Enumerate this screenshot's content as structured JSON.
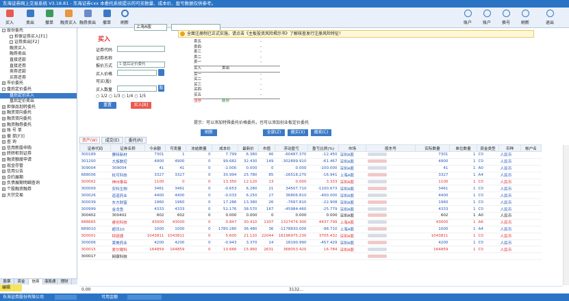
{
  "titlebar": {
    "text": "东海证券网上交易系统 V3.18.81 - 东海证券cxx  本委托系统提示的可买数量、成本价、盈亏数据仅供参考。"
  },
  "toolbar": {
    "left": [
      "买入",
      "卖出",
      "撤单",
      "融资买入",
      "融券卖出",
      "撤单",
      "刷新"
    ],
    "market": "上海A股",
    "right": [
      "账户",
      "账户",
      "账号",
      "换号",
      "刷新",
      "退出"
    ]
  },
  "notice": "全面注册制已正式实施，请点击《主板投资风险揭示书》了解核查发行注册风险特征！",
  "sidebar": {
    "items": [
      {
        "label": "股份委托",
        "level": 0,
        "box": "-"
      },
      {
        "label": "担保证券买入[F1]",
        "level": 1,
        "box": "-"
      },
      {
        "label": "证券卖出[F2]",
        "level": 1,
        "box": "-"
      },
      {
        "label": "融资买入",
        "level": 1
      },
      {
        "label": "融券卖出",
        "level": 1
      },
      {
        "label": "直接还款",
        "level": 1
      },
      {
        "label": "直接还券",
        "level": 1
      },
      {
        "label": "卖券还款",
        "level": 1
      },
      {
        "label": "买券还券",
        "level": 1
      },
      {
        "label": "市价委托",
        "level": 0,
        "box": "+"
      },
      {
        "label": "盘后定价委托",
        "level": 0,
        "box": "-"
      },
      {
        "label": "盘后定价买入",
        "level": 1,
        "selected": true
      },
      {
        "label": "盘后定价卖出",
        "level": 1
      },
      {
        "label": "担保品划转委托",
        "level": 0,
        "box": "+"
      },
      {
        "label": "融资双向委托",
        "level": 0,
        "box": "+"
      },
      {
        "label": "融资双向委托",
        "level": 0,
        "box": "+"
      },
      {
        "label": "融资融券委托",
        "level": 0,
        "box": "+"
      },
      {
        "label": "账 号 单",
        "level": 0,
        "box": "+"
      },
      {
        "label": "撤    单[F3]",
        "level": 0,
        "box": "+"
      },
      {
        "label": "查    询",
        "level": 0,
        "box": "+"
      },
      {
        "label": "信用新股申购",
        "level": 0,
        "box": "+"
      },
      {
        "label": "转转柜到证券",
        "level": 0,
        "box": "+"
      },
      {
        "label": "融资额度申请",
        "level": 0,
        "box": "+"
      },
      {
        "label": "现金存管",
        "level": 0,
        "box": "+"
      },
      {
        "label": "信用公告",
        "level": 0,
        "box": "+"
      },
      {
        "label": "合约展期",
        "level": 0,
        "box": "+"
      },
      {
        "label": "负债展期明细查询",
        "level": 0,
        "box": "+"
      },
      {
        "label": "个股融资融券",
        "level": 0,
        "box": "+"
      },
      {
        "label": "大宗交易",
        "level": 0,
        "box": "+"
      }
    ],
    "tabs": [
      "股票",
      "资金",
      "信用",
      "港股通",
      "理财"
    ],
    "edit": "编辑"
  },
  "form": {
    "title": "买入",
    "code_label": "证券代码",
    "name_label": "证券名称",
    "method_label": "报价方式",
    "method_value": "1-盘后定价委托",
    "price_label": "买入价格",
    "max_label": "可买(股)",
    "qty_label": "买入数量",
    "unit": "股",
    "radios": [
      "1/2",
      "1/3",
      "1/4",
      "1/5"
    ],
    "reset": "重置",
    "buy": "买入[B]"
  },
  "orderbook": {
    "sells": [
      "卖五",
      "卖四",
      "卖三",
      "卖二",
      "卖一"
    ],
    "buys": [
      "买一",
      "买二",
      "买三",
      "买四",
      "买五"
    ],
    "mid_labels": [
      "买入",
      "卖出"
    ],
    "bottom": [
      "涨停",
      "跌停"
    ],
    "dash": "-"
  },
  "hint": "提示：可以添加特殊委托价格委托，也可以添加创业板定价委托",
  "grid": {
    "tabs": [
      "资产(W)",
      "成交(E)",
      "委托(R)"
    ],
    "tool_buttons": [
      "刷新",
      "全部(Z)",
      "撤买(X)",
      "撤卖(C)"
    ],
    "headers": [
      "证券代码",
      "证券名称",
      "今余额",
      "可卖量",
      "冻结数量",
      "成本价",
      "最新价",
      "市值",
      "浮动盈亏",
      "盈亏比例(%)",
      "市场",
      "股东号",
      "实际数量",
      "单位数量",
      "资金类型",
      "币种",
      "帐户名"
    ],
    "rows": [
      [
        "300189",
        "赛特新材",
        "7301",
        "1",
        "0",
        "7.799",
        "6.380",
        "46",
        "-60487.370",
        "-12.450",
        "深圳A股",
        "7301",
        "1",
        "C0",
        "人民币"
      ],
      [
        "301200",
        "大族数控",
        "4900",
        "4900",
        "0",
        "99.682",
        "32.430",
        "149",
        "-302899.910",
        "-61.467",
        "深圳A股",
        "4900",
        "1",
        "C0",
        "人民币"
      ],
      [
        "309004",
        "309004",
        "41",
        "41",
        "0",
        "-1.000",
        "0.000",
        "0",
        "0.000",
        "-100.000",
        "深圳A股",
        "41",
        "1",
        "A0",
        "人民币"
      ],
      [
        "688006",
        "杭可科技",
        "3327",
        "3327",
        "0",
        "30.994",
        "25.780",
        "85",
        "-26518.270",
        "-16.941",
        "上海A股",
        "3327",
        "1",
        "A4",
        "人民币"
      ],
      [
        "300002",
        "神州泰岳",
        "1100",
        "0",
        "0",
        "13.350",
        "12.120",
        "13",
        "0.000",
        "3.333",
        "深圳A股",
        "1100",
        "1",
        "C0",
        "人民币"
      ],
      [
        "300009",
        "安科生物",
        "3461",
        "3461",
        "0",
        "-0.653",
        "6.280",
        "21",
        "34507.710",
        "-1100.673",
        "深圳A股",
        "3461",
        "1",
        "C0",
        "人民币"
      ],
      [
        "300026",
        "道道药业",
        "4400",
        "4400",
        "0",
        "-0.033",
        "6.250",
        "27",
        "36806.810",
        "-400.000",
        "深圳A股",
        "4400",
        "1",
        "C0",
        "人民币"
      ],
      [
        "300039",
        "东方财富",
        "1960",
        "1960",
        "0",
        "17.286",
        "13.380",
        "26",
        "-7697.810",
        "-22.908",
        "深圳A股",
        "1960",
        "1",
        "C0",
        "人民币"
      ],
      [
        "300999",
        "金龙鱼",
        "4333",
        "4333",
        "0",
        "51.176",
        "38.570",
        "167",
        "-45984.460",
        "-25.779",
        "深圳A股",
        "4333",
        "1",
        "C0",
        "人民币"
      ],
      [
        "300402",
        "300402",
        "602",
        "602",
        "0",
        "0.000",
        "0.000",
        "0",
        "0.000",
        "0.000",
        "深圳A股",
        "602",
        "1",
        "A0",
        "人民币"
      ],
      [
        "688665",
        "睿创科技",
        "43000",
        "43000",
        "0",
        "0.847",
        "30.410",
        "1307",
        "1327474.300",
        "4437.799",
        "上海A股",
        "43000",
        "1",
        "AK",
        "人民币"
      ],
      [
        "689010",
        "超讯10",
        "1000",
        "1000",
        "0",
        "1780.280",
        "36.480",
        "36",
        "-1178830.000",
        "-98.710",
        "上海A股",
        "1000",
        "1",
        "A4",
        "人民币"
      ],
      [
        "300001",
        "特锐德",
        "1043811",
        "1043811",
        "0",
        "5.600",
        "21.120",
        "22044",
        "16196975.230",
        "3705.432",
        "深圳A股",
        "1043811",
        "1",
        "C0",
        "人民币"
      ],
      [
        "300006",
        "莱美药业",
        "4200",
        "4200",
        "0",
        "-0.943",
        "3.370",
        "14",
        "18190.990",
        "-457.429",
        "深圳A股",
        "4200",
        "1",
        "C0",
        "人民币"
      ],
      [
        "300015",
        "爱尔眼科",
        "164859",
        "164859",
        "0",
        "13.666",
        "15.960",
        "2631",
        "368053.420",
        "16.784",
        "深圳A股",
        "164859",
        "1",
        "C0",
        "人民币"
      ],
      [
        "300017",
        "网宿科技",
        "",
        "",
        "",
        "",
        "",
        "",
        "",
        "",
        "",
        "",
        "",
        "",
        ""
      ]
    ],
    "footer": {
      "mv": "3132...",
      "mv2": "0.00"
    }
  },
  "statusbar": {
    "company": "东海证券股份有限公司",
    "account": "可用金额"
  }
}
